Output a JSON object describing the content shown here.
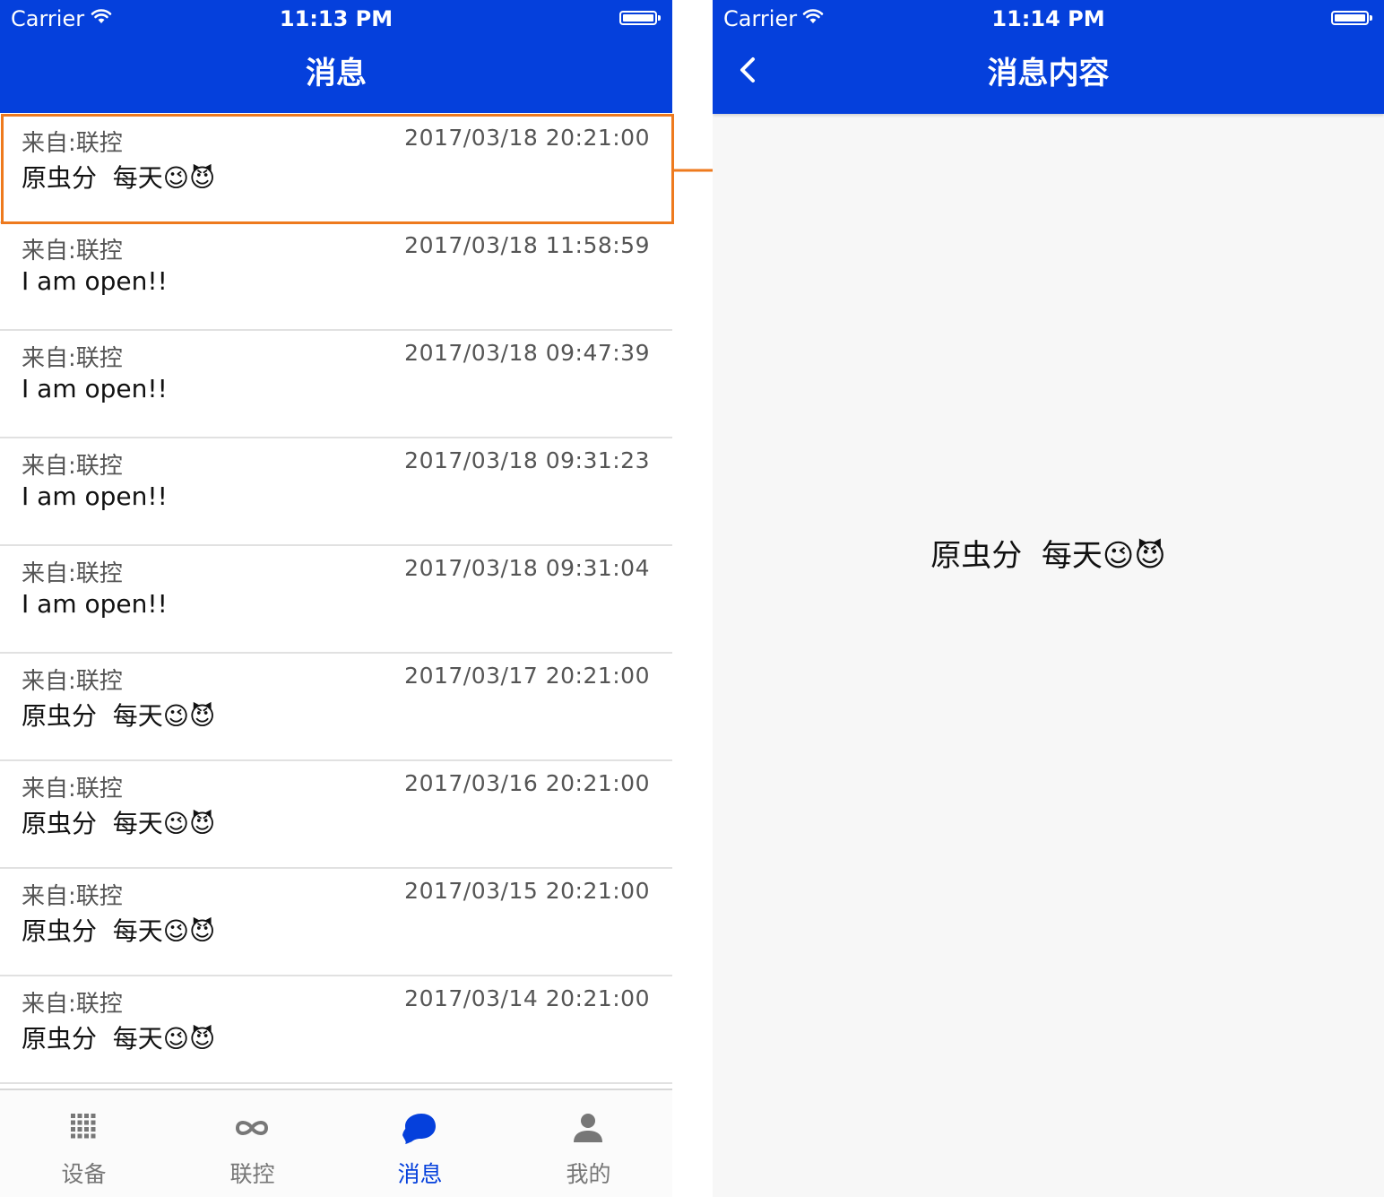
{
  "left_screen": {
    "status_bar": {
      "carrier": "Carrier",
      "time": "11:13 PM"
    },
    "nav_title": "消息",
    "messages": [
      {
        "from": "来自:联控",
        "date": "2017/03/18 20:21:00",
        "content": "原虫分  每天😉😈"
      },
      {
        "from": "来自:联控",
        "date": "2017/03/18 11:58:59",
        "content": "I am open!!"
      },
      {
        "from": "来自:联控",
        "date": "2017/03/18 09:47:39",
        "content": "I am open!!"
      },
      {
        "from": "来自:联控",
        "date": "2017/03/18 09:31:23",
        "content": "I am open!!"
      },
      {
        "from": "来自:联控",
        "date": "2017/03/18 09:31:04",
        "content": "I am open!!"
      },
      {
        "from": "来自:联控",
        "date": "2017/03/17 20:21:00",
        "content": "原虫分  每天😉😈"
      },
      {
        "from": "来自:联控",
        "date": "2017/03/16 20:21:00",
        "content": "原虫分  每天😉😈"
      },
      {
        "from": "来自:联控",
        "date": "2017/03/15 20:21:00",
        "content": "原虫分  每天😉😈"
      },
      {
        "from": "来自:联控",
        "date": "2017/03/14 20:21:00",
        "content": "原虫分  每天😉😈"
      }
    ],
    "tabs": [
      {
        "label": "设备",
        "icon": "grid-icon",
        "active": false
      },
      {
        "label": "联控",
        "icon": "infinity-icon",
        "active": false
      },
      {
        "label": "消息",
        "icon": "chat-bubble-icon",
        "active": true
      },
      {
        "label": "我的",
        "icon": "person-icon",
        "active": false
      }
    ]
  },
  "right_screen": {
    "status_bar": {
      "carrier": "Carrier",
      "time": "11:14 PM"
    },
    "nav_title": "消息内容",
    "back_icon": "chevron-left-icon",
    "content": "原虫分  每天😉😈"
  },
  "colors": {
    "nav_blue": "#0540dc",
    "highlight_orange": "#ee7a1e",
    "tab_inactive": "#777777",
    "divider": "#e1e1e1"
  }
}
